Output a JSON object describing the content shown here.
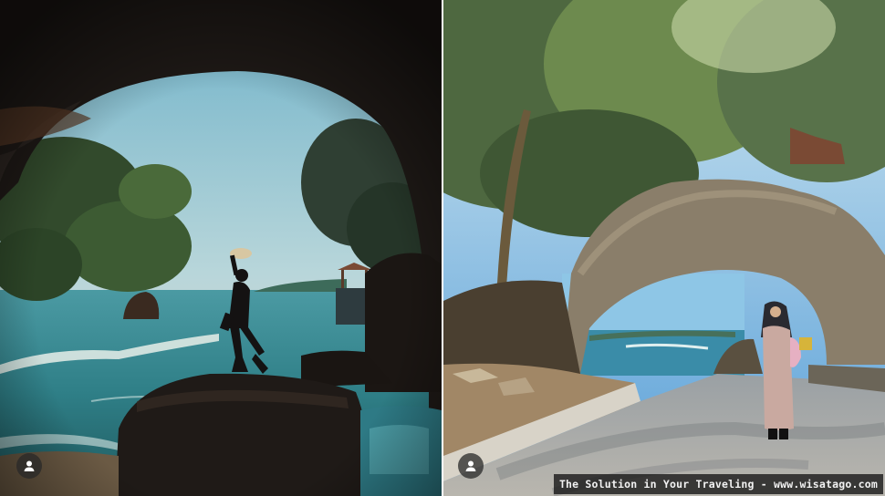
{
  "photos": [
    {
      "scene": "cave-arch-sea-silhouette",
      "avatar_icon": "user-icon"
    },
    {
      "scene": "stone-arch-bridge-walkway",
      "avatar_icon": "user-icon"
    }
  ],
  "watermark": {
    "text": "The Solution in Your Traveling - www.wisatago.com"
  },
  "colors": {
    "sky": "#8ec3d6",
    "sea": "#3e8f98",
    "rock": "#2b2420",
    "foliage": "#4a6a3a",
    "path": "#c9c6c0"
  }
}
